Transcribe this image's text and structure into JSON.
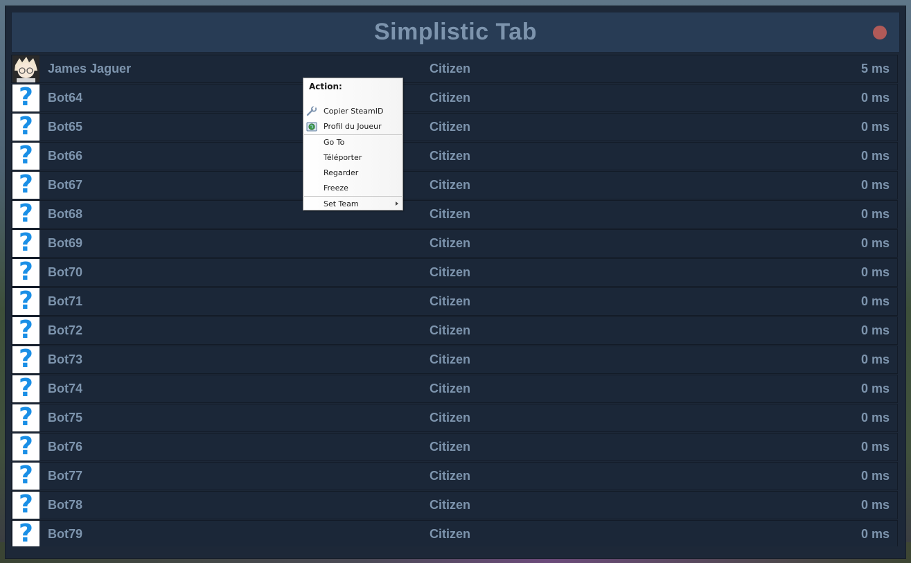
{
  "header": {
    "title": "Simplistic Tab",
    "status_color": "#b05a58"
  },
  "players": [
    {
      "name": "James Jaguer",
      "team": "Citizen",
      "ping": "5 ms",
      "avatar": "anime-avatar"
    },
    {
      "name": "Bot64",
      "team": "Citizen",
      "ping": "0 ms",
      "avatar": "question-icon"
    },
    {
      "name": "Bot65",
      "team": "Citizen",
      "ping": "0 ms",
      "avatar": "question-icon"
    },
    {
      "name": "Bot66",
      "team": "Citizen",
      "ping": "0 ms",
      "avatar": "question-icon"
    },
    {
      "name": "Bot67",
      "team": "Citizen",
      "ping": "0 ms",
      "avatar": "question-icon"
    },
    {
      "name": "Bot68",
      "team": "Citizen",
      "ping": "0 ms",
      "avatar": "question-icon"
    },
    {
      "name": "Bot69",
      "team": "Citizen",
      "ping": "0 ms",
      "avatar": "question-icon"
    },
    {
      "name": "Bot70",
      "team": "Citizen",
      "ping": "0 ms",
      "avatar": "question-icon"
    },
    {
      "name": "Bot71",
      "team": "Citizen",
      "ping": "0 ms",
      "avatar": "question-icon"
    },
    {
      "name": "Bot72",
      "team": "Citizen",
      "ping": "0 ms",
      "avatar": "question-icon"
    },
    {
      "name": "Bot73",
      "team": "Citizen",
      "ping": "0 ms",
      "avatar": "question-icon"
    },
    {
      "name": "Bot74",
      "team": "Citizen",
      "ping": "0 ms",
      "avatar": "question-icon"
    },
    {
      "name": "Bot75",
      "team": "Citizen",
      "ping": "0 ms",
      "avatar": "question-icon"
    },
    {
      "name": "Bot76",
      "team": "Citizen",
      "ping": "0 ms",
      "avatar": "question-icon"
    },
    {
      "name": "Bot77",
      "team": "Citizen",
      "ping": "0 ms",
      "avatar": "question-icon"
    },
    {
      "name": "Bot78",
      "team": "Citizen",
      "ping": "0 ms",
      "avatar": "question-icon"
    },
    {
      "name": "Bot79",
      "team": "Citizen",
      "ping": "0 ms",
      "avatar": "question-icon"
    }
  ],
  "context_menu": {
    "header": "Action:",
    "items": [
      {
        "label": "Copier SteamID",
        "icon": "wrench-icon"
      },
      {
        "label": "Profil du Joueur",
        "icon": "globe-icon"
      },
      {
        "label": "Go To"
      },
      {
        "label": "Téléporter"
      },
      {
        "label": "Regarder"
      },
      {
        "label": "Freeze"
      },
      {
        "label": "Set Team",
        "submenu": true
      }
    ]
  }
}
